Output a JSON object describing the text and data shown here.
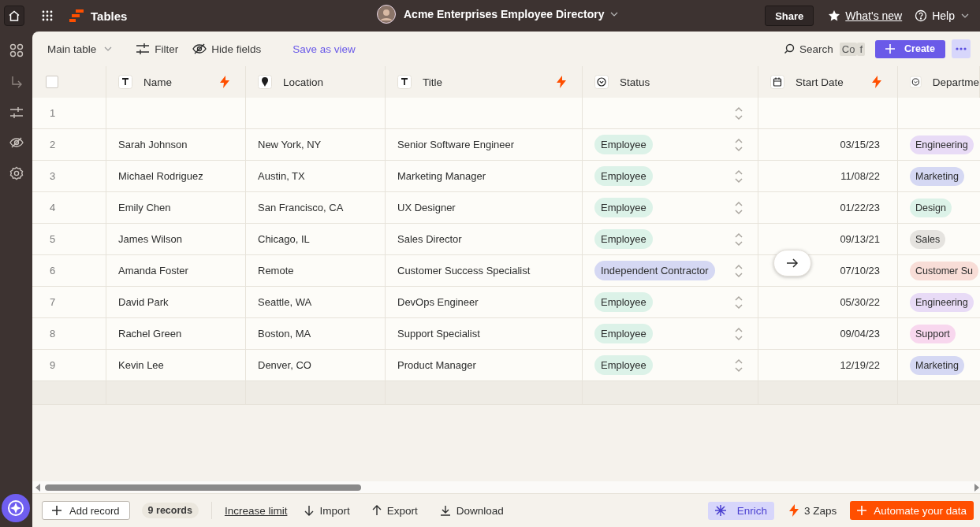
{
  "top_bar": {
    "app_name": "Tables",
    "document_title": "Acme Enterprises Employee Directory",
    "share": "Share",
    "whats_new": "What's new",
    "help": "Help"
  },
  "toolbar": {
    "view": "Main table",
    "filter": "Filter",
    "hide_fields": "Hide fields",
    "save_view": "Save as view",
    "search": "Search",
    "shortcut_keys": [
      "Co",
      "f"
    ],
    "create": "Create"
  },
  "table": {
    "select_all": {
      "checked": false
    },
    "columns": [
      {
        "label": "Name",
        "kind": "text",
        "zap": true
      },
      {
        "label": "Location",
        "kind": "location",
        "zap": false
      },
      {
        "label": "Title",
        "kind": "text",
        "zap": true
      },
      {
        "label": "Status",
        "kind": "select",
        "zap": false
      },
      {
        "label": "Start Date",
        "kind": "date",
        "zap": true
      },
      {
        "label": "Departme",
        "kind": "select",
        "zap": false
      }
    ],
    "rows": [
      {
        "number": "1"
      },
      {
        "number": "2",
        "name": "Sarah Johnson",
        "location": "New York, NY",
        "title": "Senior Software Engineer",
        "status": {
          "label": "Employee",
          "color": "#dcf2e8"
        },
        "start_date": "03/15/23",
        "department": {
          "label": "Engineering",
          "color": "#e8dbf6"
        }
      },
      {
        "number": "3",
        "name": "Michael Rodriguez",
        "location": "Austin, TX",
        "title": "Marketing Manager",
        "status": {
          "label": "Employee",
          "color": "#dcf2e8"
        },
        "start_date": "11/08/22",
        "department": {
          "label": "Marketing",
          "color": "#d5d8f3"
        }
      },
      {
        "number": "4",
        "name": "Emily Chen",
        "location": "San Francisco, CA",
        "title": "UX Designer",
        "status": {
          "label": "Employee",
          "color": "#dcf2e8"
        },
        "start_date": "01/22/23",
        "department": {
          "label": "Design",
          "color": "#dcf2e8"
        }
      },
      {
        "number": "5",
        "name": "James Wilson",
        "location": "Chicago, IL",
        "title": "Sales Director",
        "status": {
          "label": "Employee",
          "color": "#dcf2e8"
        },
        "start_date": "09/13/21",
        "department": {
          "label": "Sales",
          "color": "#e5e3df"
        }
      },
      {
        "number": "6",
        "name": "Amanda Foster",
        "location": "Remote",
        "title": "Customer Success Specialist",
        "status": {
          "label": "Independent Contractor",
          "color": "#d5d8f3"
        },
        "start_date": "07/10/23",
        "department": {
          "label": "Customer Su",
          "color": "#f8ddd7"
        }
      },
      {
        "number": "7",
        "name": "David Park",
        "location": "Seattle, WA",
        "title": "DevOps Engineer",
        "status": {
          "label": "Employee",
          "color": "#dcf2e8"
        },
        "start_date": "05/30/22",
        "department": {
          "label": "Engineering",
          "color": "#e8dbf6"
        }
      },
      {
        "number": "8",
        "name": "Rachel Green",
        "location": "Boston, MA",
        "title": "Support Specialist",
        "status": {
          "label": "Employee",
          "color": "#dcf2e8"
        },
        "start_date": "09/04/23",
        "department": {
          "label": "Support",
          "color": "#f8d7ee"
        }
      },
      {
        "number": "9",
        "name": "Kevin Lee",
        "location": "Denver, CO",
        "title": "Product Manager",
        "status": {
          "label": "Employee",
          "color": "#dcf2e8"
        },
        "start_date": "12/19/22",
        "department": {
          "label": "Marketing",
          "color": "#d5d8f3"
        }
      }
    ]
  },
  "footer": {
    "add_record": "Add record",
    "record_count": "9 records",
    "increase_limit": "Increase limit",
    "import": "Import",
    "export": "Export",
    "download": "Download",
    "enrich": "Enrich",
    "zaps": "3 Zaps",
    "automate": "Automate your data"
  }
}
